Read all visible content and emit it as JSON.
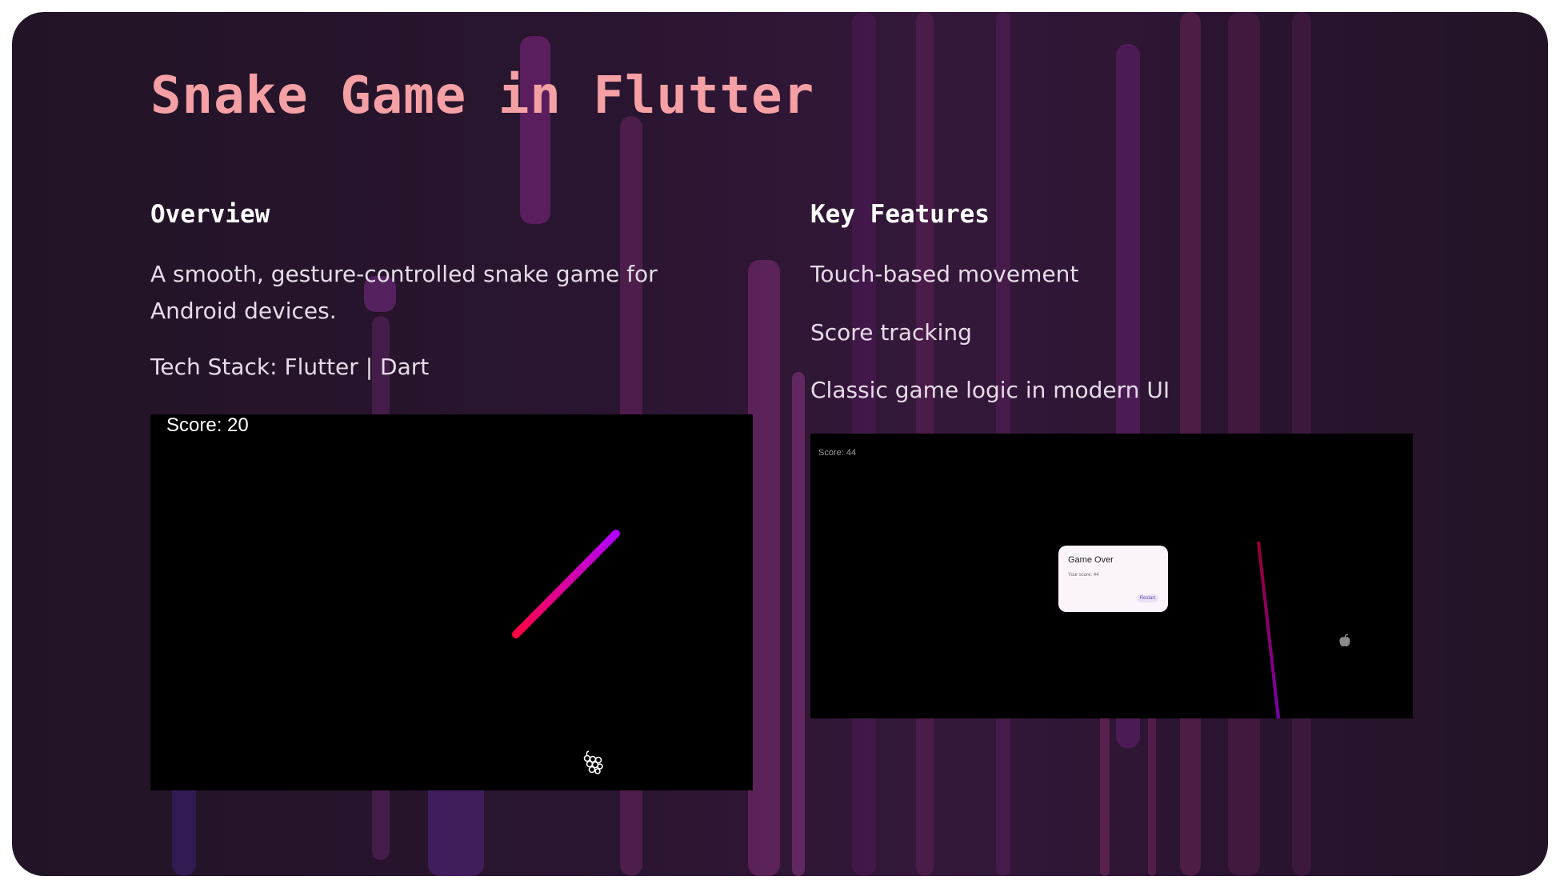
{
  "slide": {
    "title": "Snake Game in Flutter"
  },
  "overview": {
    "heading": "Overview",
    "description": "A smooth, gesture-controlled snake game for Android devices.",
    "tech_stack": "Tech Stack: Flutter | Dart"
  },
  "features": {
    "heading": "Key Features",
    "items": [
      "Touch-based movement",
      "Score tracking",
      "Classic game logic in modern UI"
    ]
  },
  "screenshot_gameplay": {
    "score_text": "Score: 20",
    "food_icon": "grapes-icon"
  },
  "screenshot_game_over": {
    "score_text": "Score: 44",
    "dialog_title": "Game Over",
    "dialog_score": "Your score: 44",
    "dialog_button": "Restart",
    "food_icon": "apple-icon"
  },
  "colors": {
    "title": "#f4a0a4",
    "heading": "#ffffff",
    "body": "#e6dbe8",
    "snake_start": "#ff0040",
    "snake_end": "#b000ff"
  }
}
